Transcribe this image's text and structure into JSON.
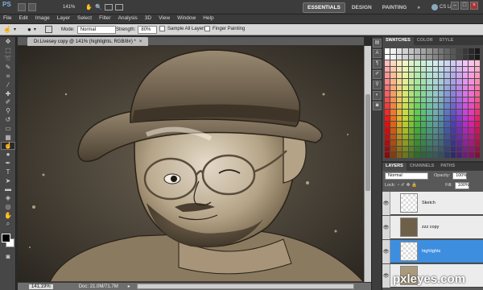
{
  "app": {
    "logo": "PS",
    "zoom_dropdown": "141%"
  },
  "workspaces": {
    "essentials": "ESSENTIALS",
    "design": "DESIGN",
    "painting": "PAINTING",
    "more": "»",
    "cslive": "CS Live"
  },
  "window_controls": {
    "minimize": "–",
    "restore": "□",
    "close": "×"
  },
  "menu": [
    "File",
    "Edit",
    "Image",
    "Layer",
    "Select",
    "Filter",
    "Analysis",
    "3D",
    "View",
    "Window",
    "Help"
  ],
  "options": {
    "mode_label": "Mode:",
    "mode_value": "Normal",
    "strength_label": "Strength:",
    "strength_value": "80%",
    "sample_all_layers": "Sample All Layers",
    "finger_painting": "Finger Painting"
  },
  "document": {
    "tab_title": "Dr.Livesey copy @ 141% (highlights, RGB/8#) *",
    "tab_close": "×"
  },
  "status": {
    "zoom": "141,19%",
    "doc": "Doc: 21.0M/71.7M"
  },
  "swatch_tabs": [
    "SWATCHES",
    "COLOR",
    "STYLE"
  ],
  "layers_panel": {
    "tabs": [
      "LAYERS",
      "CHANNELS",
      "PATHS"
    ],
    "blend_mode": "Normal",
    "opacity_label": "Opacity:",
    "opacity_value": "100%",
    "lock_label": "Lock:",
    "fill_label": "Fill:",
    "fill_value": "100%",
    "layers": [
      {
        "name": "Sketch",
        "visible": true,
        "active": false
      },
      {
        "name": "zzz copy",
        "visible": true,
        "active": false
      },
      {
        "name": "highlights",
        "visible": true,
        "active": true
      },
      {
        "name": "",
        "visible": true,
        "active": false
      }
    ]
  },
  "watermark": "pxleyes.com",
  "colors": {
    "accent": "#3e8ee0",
    "sepia": "#8a7555"
  }
}
